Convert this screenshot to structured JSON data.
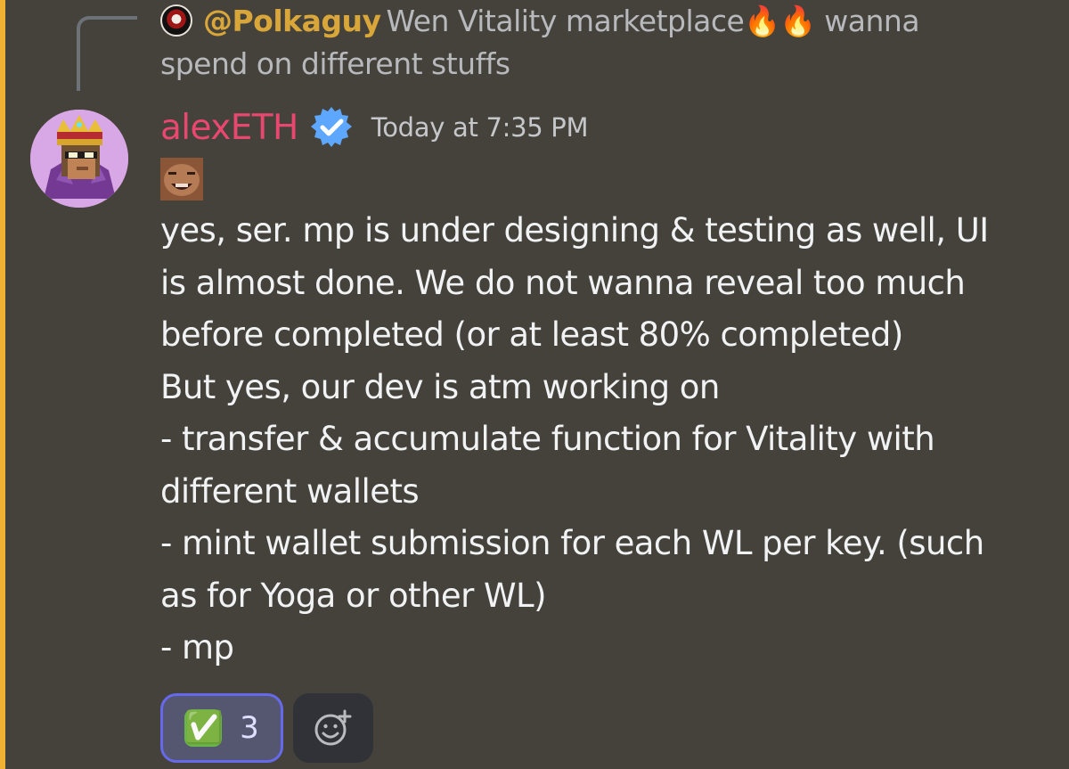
{
  "reply_preview": {
    "author": "@Polkaguy",
    "text_before": "Wen Vitality marketplace",
    "text_after": "wanna",
    "text_continuation": "spend on different stuffs",
    "emojis": [
      "🔥",
      "🔥"
    ]
  },
  "message": {
    "author": "alexETH",
    "timestamp": "Today at 7:35 PM",
    "lines": [
      "yes, ser.  mp is under designing & testing as well, UI",
      "is almost done. We do not wanna reveal too much",
      "before completed (or at least 80% completed)",
      "But yes, our dev is atm working on",
      "- transfer & accumulate function for Vitality with",
      "different wallets",
      "- mint wallet submission for each WL per key. (such",
      "as for Yoga or other WL)",
      "- mp"
    ]
  },
  "reaction": {
    "emoji": "✅",
    "count": "3"
  },
  "colors": {
    "background": "#45423b",
    "mention_bar": "#f0b232",
    "username": "#e8476f",
    "reply_author": "#d9a63a",
    "reaction_border": "#6669ea"
  },
  "icons": {
    "verified": "verified-badge-icon",
    "add_reaction": "add-reaction-smiley-icon"
  }
}
